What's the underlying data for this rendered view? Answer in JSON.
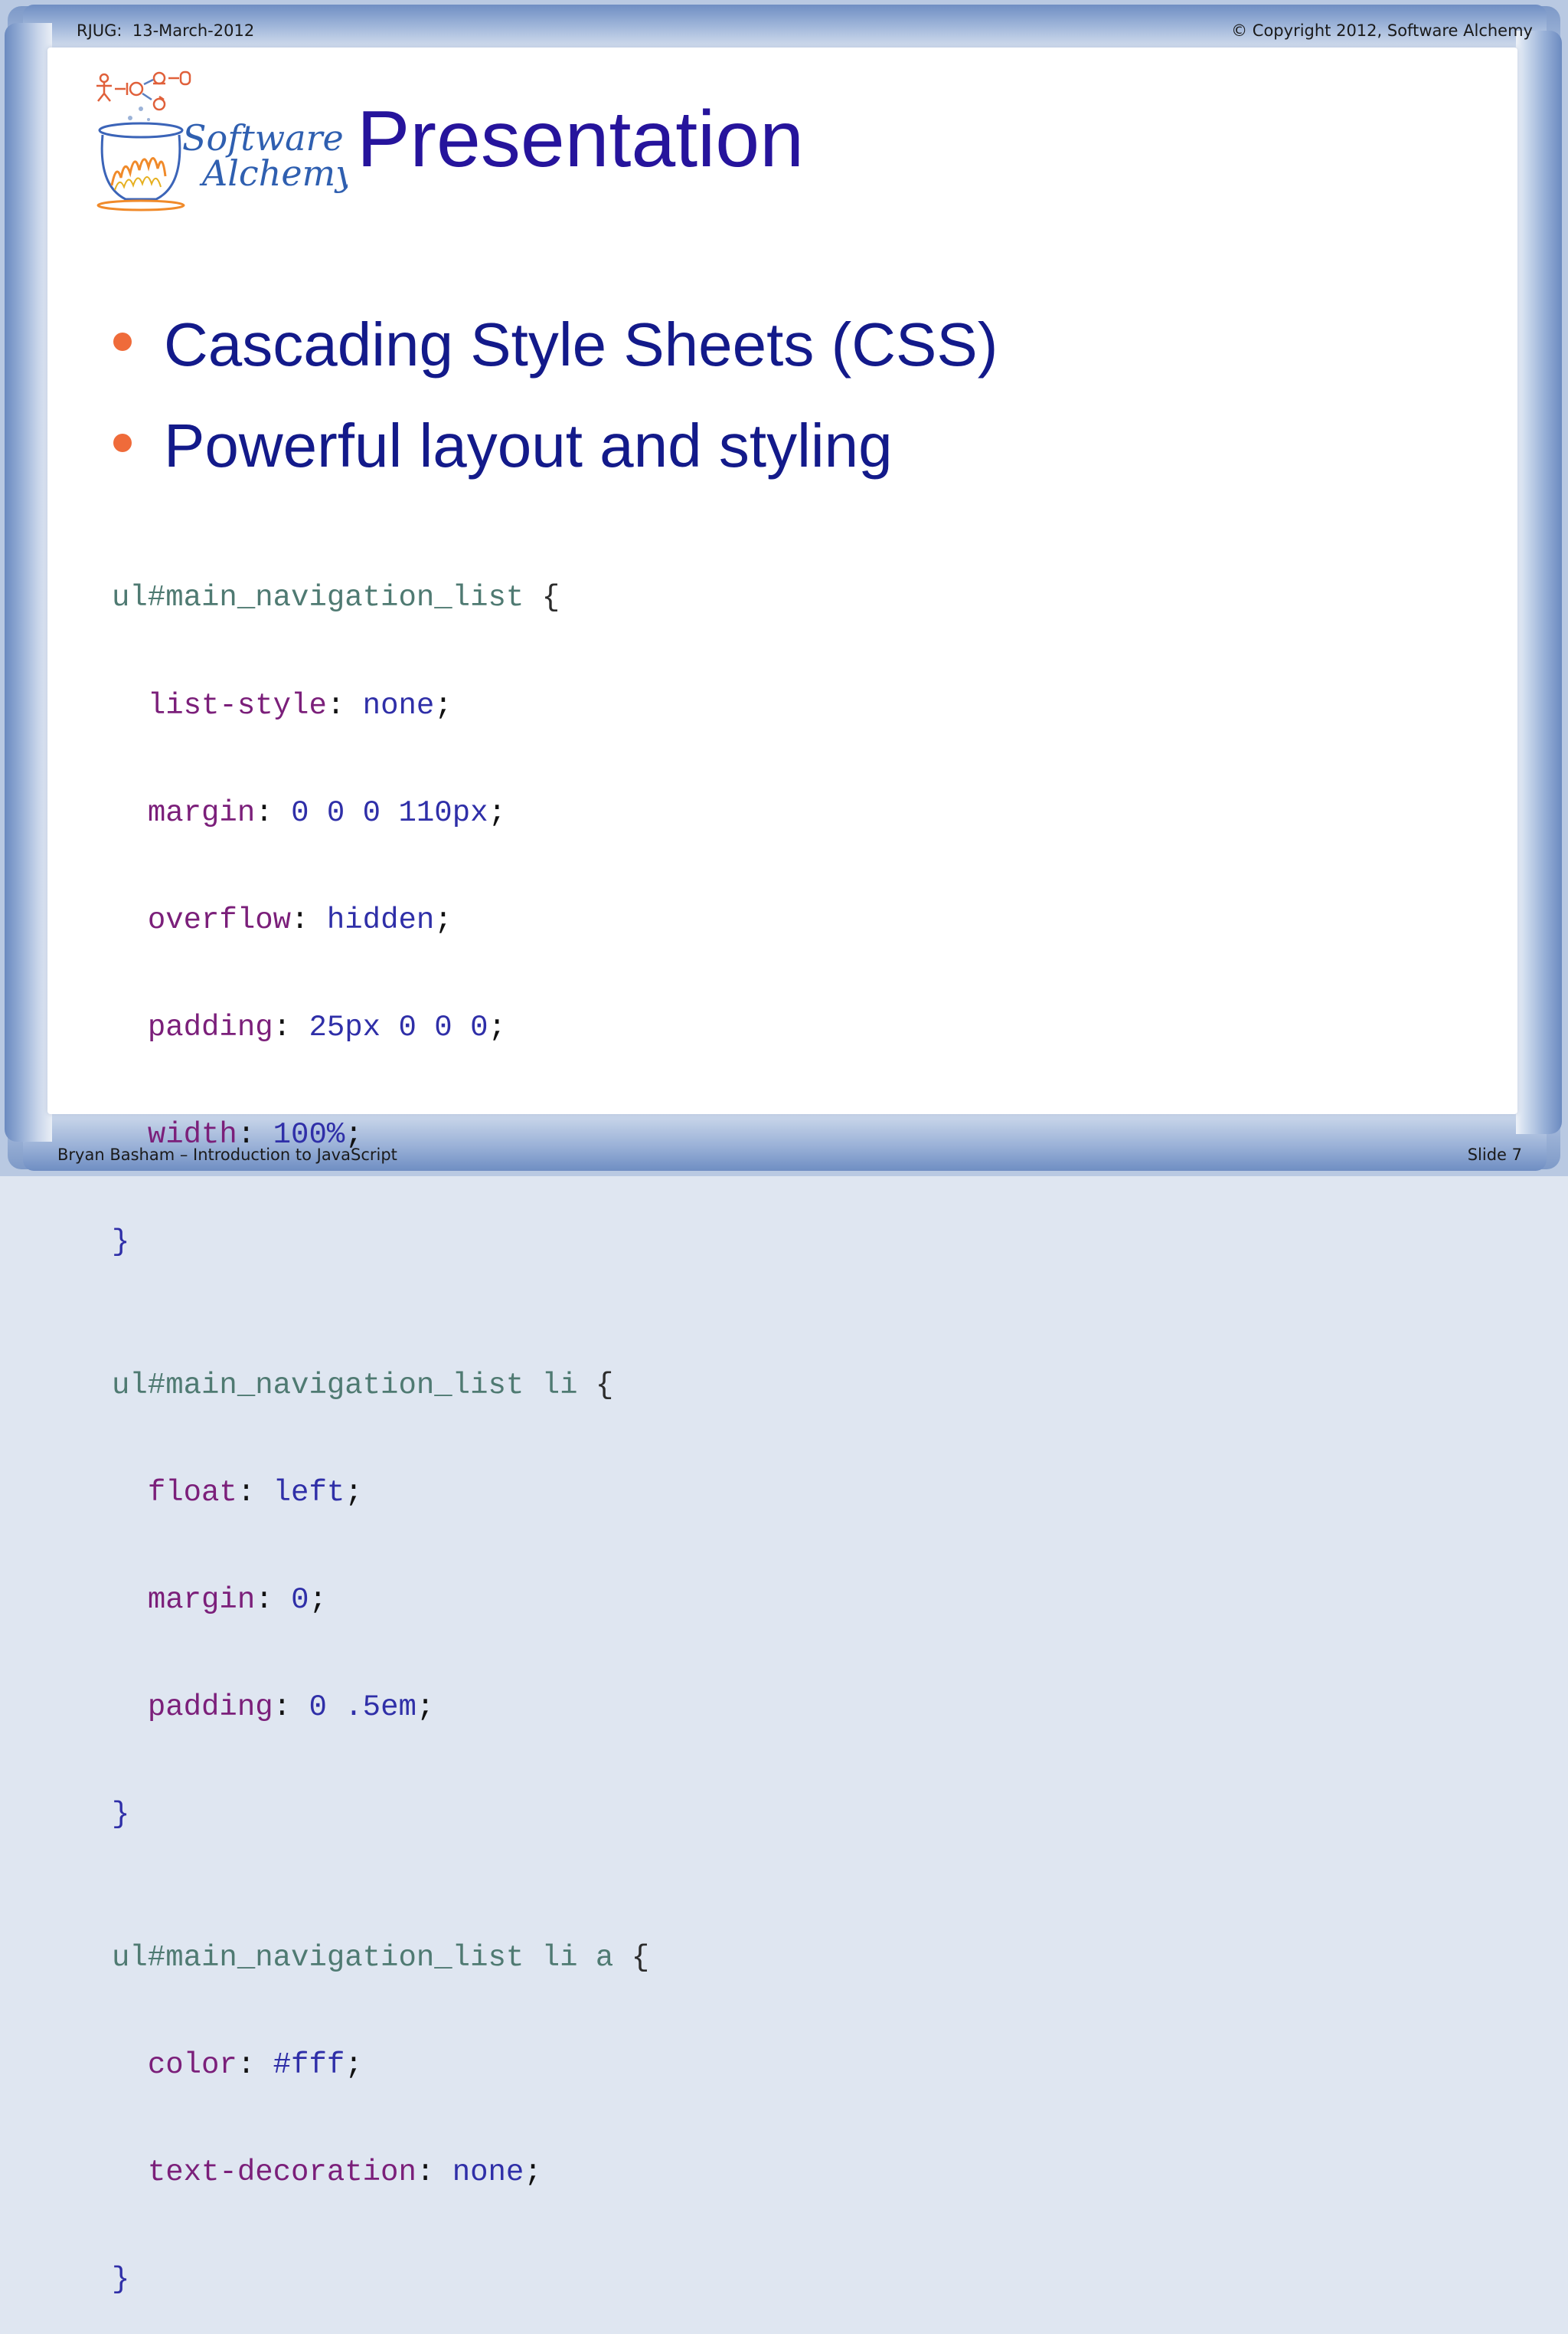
{
  "header": {
    "left": "RJUG:  13-March-2012",
    "right": "© Copyright 2012, Software Alchemy"
  },
  "footer": {
    "left": "Bryan Basham – Introduction to JavaScript",
    "right": "Slide 7"
  },
  "logo": {
    "line1": "Software",
    "line2": "Alchemy"
  },
  "title": "Presentation",
  "bullets": [
    "Cascading Style Sheets (CSS)",
    "Powerful layout and styling"
  ],
  "code": {
    "block1": {
      "selector": "ul#main_navigation_list",
      "open": " {",
      "decls": [
        {
          "prop": "list-style",
          "value": "none"
        },
        {
          "prop": "margin",
          "value": "0 0 0 110px"
        },
        {
          "prop": "overflow",
          "value": "hidden"
        },
        {
          "prop": "padding",
          "value": "25px 0 0 0"
        },
        {
          "prop": "width",
          "value": "100%"
        }
      ],
      "close": "}"
    },
    "block2": {
      "selector": "ul#main_navigation_list li",
      "open": " {",
      "decls": [
        {
          "prop": "float",
          "value": "left"
        },
        {
          "prop": "margin",
          "value": "0"
        },
        {
          "prop": "padding",
          "value": "0 .5em"
        }
      ],
      "close": "}"
    },
    "block3": {
      "selector": "ul#main_navigation_list li a",
      "open": " {",
      "decls": [
        {
          "prop": "color",
          "value": "#fff"
        },
        {
          "prop": "text-decoration",
          "value": "none"
        }
      ],
      "close": "}"
    }
  },
  "colors": {
    "title": "#26149c",
    "bullet_text": "#131a8a",
    "bullet_dot": "#ef6b3a",
    "frame": "#7d99c8"
  }
}
